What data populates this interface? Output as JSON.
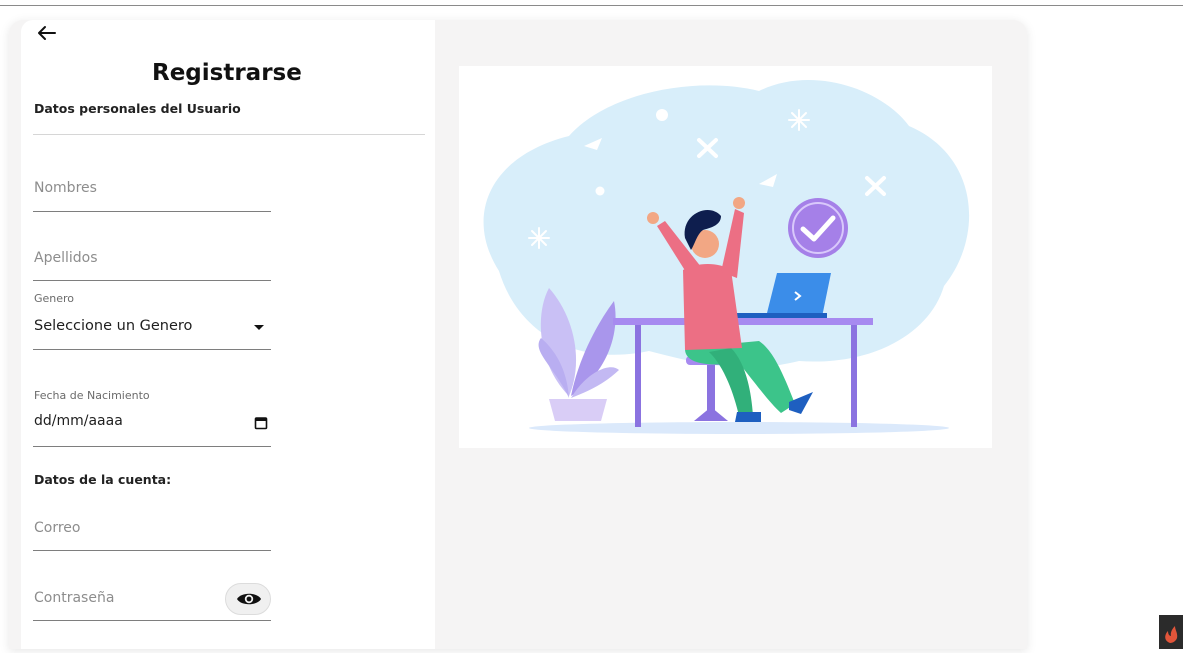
{
  "header": {
    "title": "Registrarse"
  },
  "sections": {
    "personal": "Datos personales del Usuario",
    "account": "Datos de la cuenta:"
  },
  "fields": {
    "nombres": {
      "placeholder": "Nombres"
    },
    "apellidos": {
      "placeholder": "Apellidos"
    },
    "genero": {
      "label": "Genero",
      "value": "Seleccione un Genero"
    },
    "fecha": {
      "label": "Fecha de Nacimiento",
      "value": "dd/mm/aaaa"
    },
    "correo": {
      "placeholder": "Correo"
    },
    "contrasena": {
      "placeholder": "Contraseña"
    }
  },
  "icons": {
    "back": "arrow-left-icon",
    "dropdown": "caret-down-icon",
    "calendar": "calendar-icon",
    "eye": "eye-icon"
  },
  "colors": {
    "cloud": "#d8eefa",
    "person_shirt": "#ec6f84",
    "person_pants": "#3cc48a",
    "desk": "#a78af0",
    "laptop": "#3b8de9",
    "check_badge": "#a580e8"
  }
}
